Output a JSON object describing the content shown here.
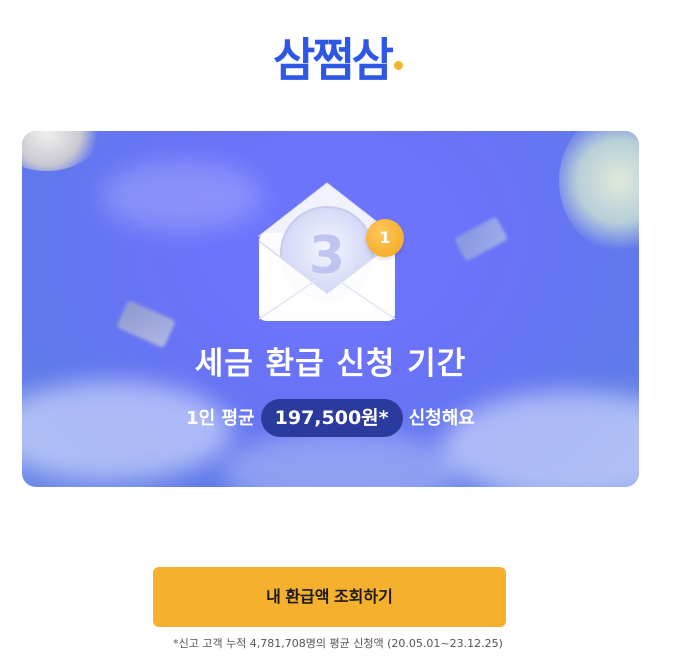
{
  "logo": {
    "text": "삼쩜삼"
  },
  "banner": {
    "badge_count": "1",
    "envelope_number": "3",
    "headline": "세금 환급 신청 기간",
    "sub_prefix": "1인 평균",
    "sub_amount": "197,500원*",
    "sub_suffix": "신청해요"
  },
  "cta": {
    "label": "내 환급액 조회하기"
  },
  "footnote": {
    "text": "*신고 고객 누적 4,781,708명의 평균 신청액 (20.05.01~23.12.25)"
  },
  "colors": {
    "brand_blue": "#2f57e6",
    "accent_yellow": "#f5b12e",
    "banner_blue": "#6e75ff",
    "pill_navy": "#2a3a9d"
  }
}
